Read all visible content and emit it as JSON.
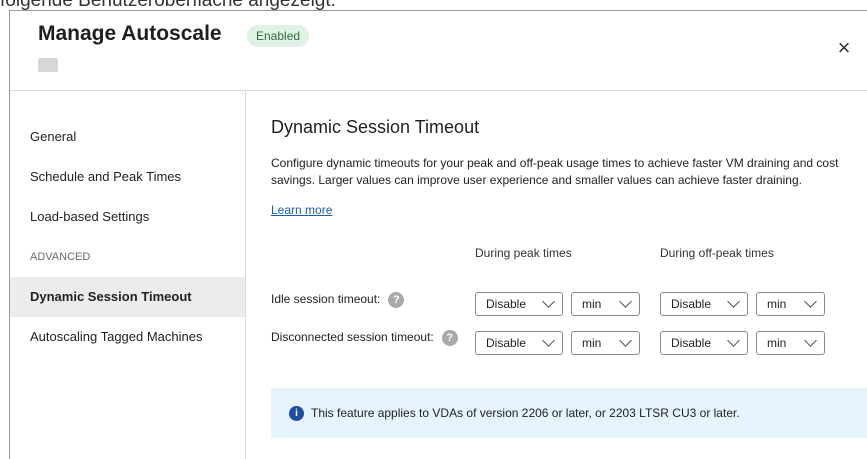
{
  "caption": "folgende Benutzeroberfläche angezeigt:",
  "dialog": {
    "title": "Manage Autoscale",
    "status_badge": "Enabled",
    "close_symbol": "×"
  },
  "sidebar": {
    "items": [
      {
        "label": "General"
      },
      {
        "label": "Schedule and Peak Times"
      },
      {
        "label": "Load-based Settings"
      },
      {
        "label": "ADVANCED"
      },
      {
        "label": "Dynamic Session Timeout"
      },
      {
        "label": "Autoscaling Tagged Machines"
      }
    ]
  },
  "main": {
    "heading": "Dynamic Session Timeout",
    "description": "Configure dynamic timeouts for your peak and off-peak usage times to achieve faster VM draining and cost savings. Larger values can improve user experience and smaller values can achieve faster draining.",
    "learn_more": "Learn more",
    "col_peak": "During peak times",
    "col_offpeak": "During off-peak times",
    "rows": [
      {
        "label": "Idle session timeout:",
        "peak_value": "Disable",
        "peak_unit": "min",
        "offpeak_value": "Disable",
        "offpeak_unit": "min"
      },
      {
        "label": "Disconnected session timeout:",
        "peak_value": "Disable",
        "peak_unit": "min",
        "offpeak_value": "Disable",
        "offpeak_unit": "min"
      }
    ],
    "help_symbol": "?",
    "info_symbol": "i",
    "info_text": "This feature applies to VDAs of version 2206 or later, or 2203 LTSR CU3 or later."
  },
  "colors": {
    "accent_link": "#1b5eb0",
    "badge_bg": "#dff3e4",
    "info_bg": "#e6f4fc",
    "active_nav_bg": "#ececec"
  }
}
